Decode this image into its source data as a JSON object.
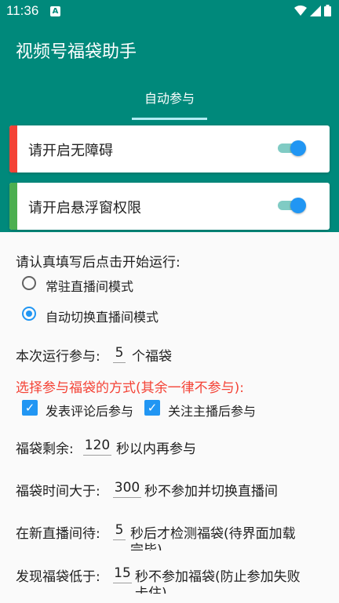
{
  "status_bar": {
    "time": "11:36",
    "notif_letter": "A"
  },
  "app": {
    "title": "视频号福袋助手",
    "tab_label": "自动参与"
  },
  "colors": {
    "primary": "#00897B",
    "accent": "#2196F3",
    "red": "#F44336",
    "green": "#4CAF50",
    "warning_text": "#F44336"
  },
  "permissions": [
    {
      "label": "请开启无障碍",
      "enabled": true
    },
    {
      "label": "请开启悬浮窗权限",
      "enabled": true
    }
  ],
  "form": {
    "intro": "请认真填写后点击开始运行:",
    "modes": [
      {
        "label": "常驻直播间模式",
        "selected": false
      },
      {
        "label": "自动切换直播间模式",
        "selected": true
      }
    ],
    "run_count": {
      "prefix": "本次运行参与:",
      "value": "5",
      "suffix": "个福袋"
    },
    "method_heading": "选择参与福袋的方式(其余一律不参与):",
    "methods": [
      {
        "label": "发表评论后参与",
        "checked": true
      },
      {
        "label": "关注主播后参与",
        "checked": true
      }
    ],
    "remaining": {
      "prefix": "福袋剩余:",
      "value": "120",
      "suffix": "秒以内再参与"
    },
    "duration": {
      "prefix": "福袋时间大于:",
      "value": "300",
      "suffix": "秒不参加并切换直播间"
    },
    "new_room_wait": {
      "prefix": "在新直播间待:",
      "value": "5",
      "suffix_line1": "秒后才检测福袋(待界面加载",
      "suffix_line2": "完毕)"
    },
    "low_found": {
      "prefix": "发现福袋低于:",
      "value": "15",
      "suffix_line1": "秒不参加福袋(防止参加失败",
      "suffix_line2": "卡住)"
    }
  }
}
